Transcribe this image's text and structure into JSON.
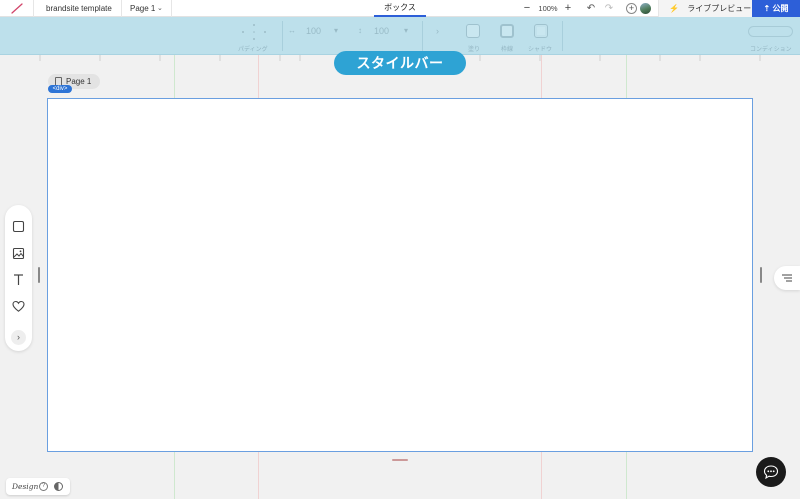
{
  "topbar": {
    "site_name": "brandsite template",
    "page_selector": "Page 1",
    "active_tab": "ボックス",
    "zoom_minus": "−",
    "zoom_level": "100%",
    "zoom_plus": "+",
    "undo": "↶",
    "redo": "↷",
    "add_collaborator": "+",
    "preview_label": "ライブプレビュー",
    "preview_icon": "⚡",
    "publish_label": "公開",
    "publish_icon": "⇡"
  },
  "stylebar": {
    "overlay_label": "スタイルバー",
    "padding_label": "パディング",
    "width_value": "100",
    "height_value": "100",
    "fill_label": "塗り",
    "border_label": "枠線",
    "shadow_label": "シャドウ",
    "condition_label": "コンディション"
  },
  "canvas": {
    "page_tab_label": "Page 1",
    "element_tag": "<div>"
  },
  "tools": {
    "items": [
      "box-tool",
      "image-tool",
      "text-tool",
      "favorite-tool"
    ],
    "more": "›"
  },
  "bottom": {
    "mode_label": "Design",
    "help": "?"
  },
  "colors": {
    "accent": "#2d5fd8",
    "stylebar_overlay": "#bde0eb",
    "badge": "#2ea3d4",
    "selection": "#6a9fe0"
  }
}
